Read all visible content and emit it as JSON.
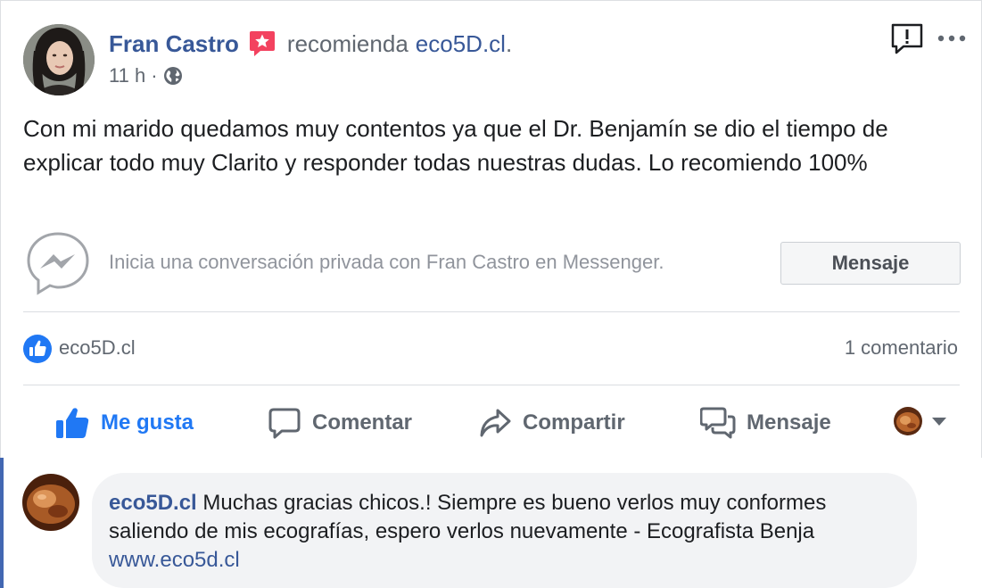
{
  "post": {
    "author": "Fran Castro",
    "action_text": "recomienda",
    "page_name": "eco5D.cl",
    "page_suffix": ".",
    "timestamp": "11 h",
    "meta_separator": "·",
    "privacy_icon": "globe-icon",
    "body": "Con mi marido quedamos muy contentos ya que el Dr. Benjamín se dio el tiempo de explicar todo muy Clarito y responder todas nuestras dudas. Lo recomiendo 100%"
  },
  "messenger": {
    "prompt": "Inicia una conversación privada con Fran Castro en Messenger.",
    "button_label": "Mensaje"
  },
  "reactions": {
    "reactor": "eco5D.cl",
    "comment_count": "1 comentario"
  },
  "actions": {
    "like": "Me gusta",
    "comment": "Comentar",
    "share": "Compartir",
    "message": "Mensaje"
  },
  "comment": {
    "author": "eco5D.cl",
    "text": "Muchas gracias chicos.! Siempre es bueno verlos muy conformes saliendo de mis ecografías, espero verlos nuevamente - Ecografista Benja",
    "link": "www.eco5d.cl"
  },
  "colors": {
    "link_blue": "#385898",
    "like_blue": "#2078f4",
    "recommend_red": "#f3425f",
    "muted_gray": "#606770",
    "bubble_bg": "#f2f3f5"
  }
}
